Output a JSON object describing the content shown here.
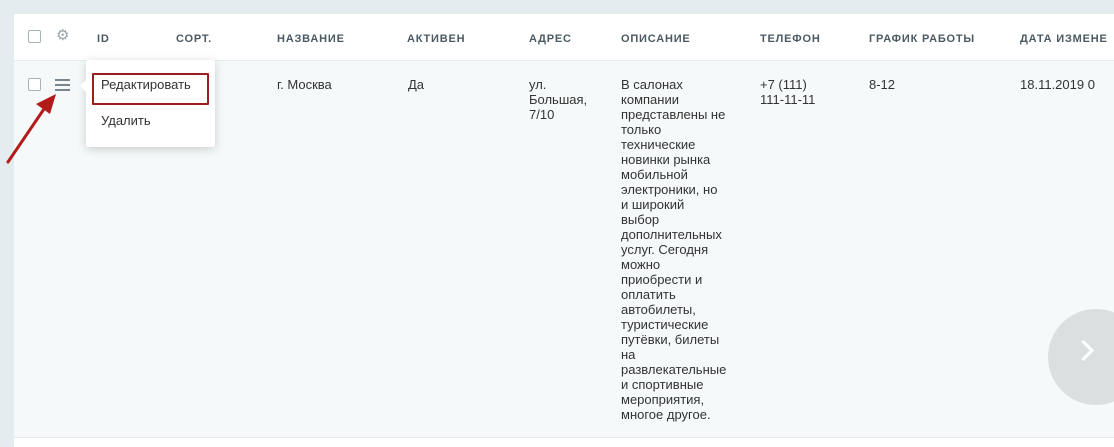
{
  "table": {
    "columns": {
      "id": "ID",
      "sort": "СОРТ.",
      "name": "НАЗВАНИЕ",
      "active": "АКТИВЕН",
      "address": "АДРЕС",
      "description": "ОПИСАНИЕ",
      "phone": "ТЕЛЕФОН",
      "schedule": "ГРАФИК РАБОТЫ",
      "date_modified": "ДАТА ИЗМЕНЕ"
    },
    "row": {
      "name": "г. Москва",
      "active": "Да",
      "address_lines": [
        "ул.",
        "Большая,",
        "7/10"
      ],
      "description_lines": [
        "В салонах",
        "компании",
        "представлены не",
        "только",
        "технические",
        "новинки рынка",
        "мобильной",
        "электроники, но",
        "и широкий",
        "выбор",
        "дополнительных",
        "услуг. Сегодня",
        "можно",
        "приобрести и",
        "оплатить",
        "автобилеты,",
        "туристические",
        "путёвки, билеты",
        "на",
        "развлекательные",
        "и спортивные",
        "мероприятия,",
        "многое другое."
      ],
      "phone_lines": [
        "+7 (111)",
        "111-11-11"
      ],
      "schedule": "8-12",
      "date_modified": "18.11.2019 0"
    }
  },
  "context_menu": {
    "edit_label": "Редактировать",
    "delete_label": "Удалить"
  },
  "icons": {
    "settings": "gear-icon",
    "row_menu": "menu-icon",
    "next": "chevron-right-icon",
    "annotation": "red-arrow"
  },
  "colors": {
    "highlight_border": "#a01c1c",
    "annotation_arrow": "#b31b1b",
    "row_background": "#f5f9f9",
    "page_background": "#e3ecee"
  }
}
